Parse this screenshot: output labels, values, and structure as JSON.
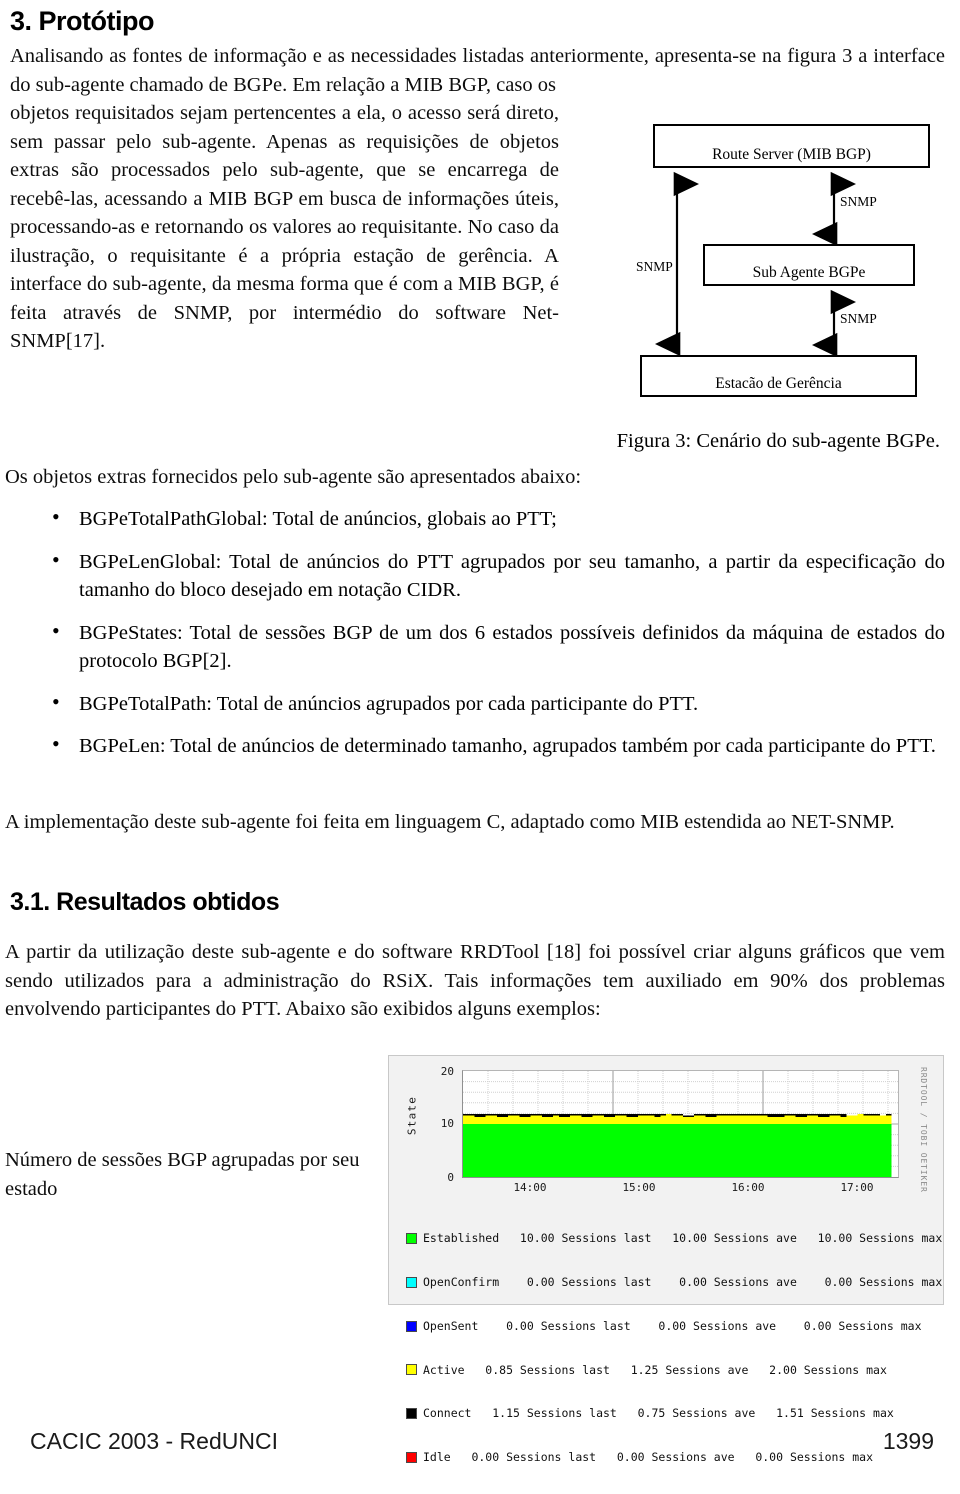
{
  "section": {
    "number_title": "3. Protótipo",
    "subsection_title": "3.1. Resultados obtidos"
  },
  "paragraphs": {
    "intro": "Analisando as fontes de informação e as necessidades listadas anteriormente, apresenta-se na figura 3 a interface do sub-agente chamado de BGPe.   Em relação a MIB BGP, caso os",
    "left_column": "objetos requisitados sejam pertencentes a ela, o acesso será direto, sem passar pelo sub-agente. Apenas as requisições de objetos extras são processados pelo sub-agente, que se encarrega de recebê-las, acessando a MIB BGP em busca de informações úteis, processando-as e retornando os valores ao requisitante. No caso da ilustração, o requisitante é a própria estação de gerência. A interface do sub-agente, da mesma forma que é com a MIB BGP, é feita através de SNMP, por intermédio do software Net-SNMP[17].",
    "objects_intro": "Os objetos extras fornecidos pelo sub-agente são apresentados abaixo:",
    "implementation": "A implementação deste sub-agente foi feita em linguagem C, adaptado como MIB estendida ao NET-SNMP.",
    "results": "A partir da utilização deste sub-agente e do software RRDTool [18] foi possível criar alguns gráficos que vem sendo utilizados para a administração do RSiX. Tais informações tem auxiliado em 90% dos problemas envolvendo participantes do PTT. Abaixo são exibidos alguns exemplos:"
  },
  "figure3": {
    "caption": "Figura 3: Cenário do sub-agente BGPe.",
    "boxes": [
      {
        "id": "route-server",
        "label": "Route Server (MIB BGP)"
      },
      {
        "id": "sub-agent",
        "label": "Sub Agente BGPe"
      },
      {
        "id": "management-station",
        "label": "Estacão de Gerência"
      }
    ],
    "arrow_labels": {
      "left": "SNMP",
      "top_right": "SNMP",
      "bottom_right": "SNMP"
    }
  },
  "bullets": [
    "BGPeTotalPathGlobal: Total de anúncios, globais ao PTT;",
    "BGPeLenGlobal: Total de anúncios do PTT agrupados por seu tamanho, a partir da especificação do tamanho do bloco desejado em notação CIDR.",
    "BGPeStates: Total de sessões BGP de um dos 6 estados possíveis definidos da máquina de estados do protocolo BGP[2].",
    "BGPeTotalPath: Total de anúncios agrupados por cada participante do PTT.",
    "BGPeLen: Total de anúncios de determinado tamanho, agrupados também por cada participante do PTT."
  ],
  "graph_caption": "Número de sessões BGP agrupadas por seu estado",
  "chart_data": {
    "type": "area",
    "title": "",
    "xlabel": "",
    "ylabel": "State",
    "ylim": [
      0,
      20
    ],
    "yticks": [
      0,
      10,
      20
    ],
    "xticks": [
      "14:00",
      "15:00",
      "16:00",
      "17:00"
    ],
    "grid": true,
    "stacked": true,
    "watermark": "RRDTOOL / TOBI OETIKER",
    "legend_position": "below",
    "series": [
      {
        "name": "Established",
        "color": "#00ff00",
        "last": "10.00",
        "ave": "10.00",
        "max": "10.00",
        "unit": "Sessions"
      },
      {
        "name": "OpenConfirm",
        "color": "#00ffff",
        "last": "0.00",
        "ave": "0.00",
        "max": "0.00",
        "unit": "Sessions"
      },
      {
        "name": "OpenSent",
        "color": "#0000ff",
        "last": "0.00",
        "ave": "0.00",
        "max": "0.00",
        "unit": "Sessions"
      },
      {
        "name": "Active",
        "color": "#ffff00",
        "last": "0.85",
        "ave": "1.25",
        "max": "2.00",
        "unit": "Sessions"
      },
      {
        "name": "Connect",
        "color": "#000000",
        "last": "1.15",
        "ave": "0.75",
        "max": "1.51",
        "unit": "Sessions"
      },
      {
        "name": "Idle",
        "color": "#ff0000",
        "last": "0.00",
        "ave": "0.00",
        "max": "0.00",
        "unit": "Sessions"
      }
    ],
    "legend_rows": [
      "Established   10.00 Sessions last   10.00 Sessions ave   10.00 Sessions max",
      "OpenConfirm    0.00 Sessions last    0.00 Sessions ave    0.00 Sessions max",
      "OpenSent    0.00 Sessions last    0.00 Sessions ave    0.00 Sessions max",
      "Active   0.85 Sessions last   1.25 Sessions ave   2.00 Sessions max",
      "Connect   1.15 Sessions last   0.75 Sessions ave   1.51 Sessions max",
      "Idle   0.00 Sessions last   0.00 Sessions ave   0.00 Sessions max"
    ],
    "established_level": 10,
    "active_top": [
      11.6,
      11.6,
      11.3,
      11.3,
      11.6,
      11.6,
      11.3,
      11.3,
      11.6,
      11.6,
      11.3,
      11.3,
      11.6,
      11.6,
      11.3,
      11.3,
      11.6,
      11.3,
      11.3,
      11.6,
      11.6,
      11.3,
      11.3,
      11.6,
      11.6,
      11.3,
      11.3,
      11.6,
      11.6,
      11.3,
      11.3,
      11.6,
      11.6,
      11.6,
      11.3,
      11.6,
      11.9,
      11.6,
      11.6,
      11.3,
      11.3,
      11.6,
      11.6,
      11.3,
      11.3,
      11.6,
      11.6,
      11.6,
      11.6,
      11.6,
      11.6,
      11.6,
      11.6,
      11.6,
      11.3,
      11.3,
      11.3,
      11.6,
      11.6,
      11.3,
      11.3,
      11.6,
      11.6,
      11.3,
      11.3,
      11.6,
      11.6,
      11.3,
      11.6,
      11.6,
      11.9,
      11.6,
      11.6,
      11.6,
      11.6,
      11.6
    ],
    "connect_top": [
      11.9,
      11.9,
      11.9,
      11.9,
      11.9,
      11.9,
      11.9,
      11.9,
      11.9,
      11.9,
      11.9,
      11.9,
      11.9,
      11.9,
      11.9,
      11.9,
      11.9,
      11.9,
      11.9,
      11.9,
      11.9,
      11.9,
      11.9,
      11.9,
      11.9,
      11.9,
      11.9,
      11.9,
      11.9,
      11.9,
      11.9,
      11.9,
      11.9,
      11.9,
      11.9,
      11.9,
      11.9,
      11.9,
      11.9,
      11.6,
      11.6,
      11.9,
      11.9,
      11.9,
      11.9,
      11.9,
      11.9,
      11.9,
      11.9,
      11.9,
      11.9,
      11.9,
      11.9,
      11.9,
      11.9,
      11.9,
      11.9,
      11.9,
      11.9,
      11.9,
      11.9,
      11.9,
      11.9,
      11.9,
      11.9,
      11.9,
      11.9,
      11.9,
      11.6,
      11.6,
      11.9,
      11.9,
      11.9,
      11.9,
      11.6,
      11.9
    ]
  },
  "footer": {
    "left": "CACIC 2003 - RedUNCI",
    "page": "1399"
  }
}
